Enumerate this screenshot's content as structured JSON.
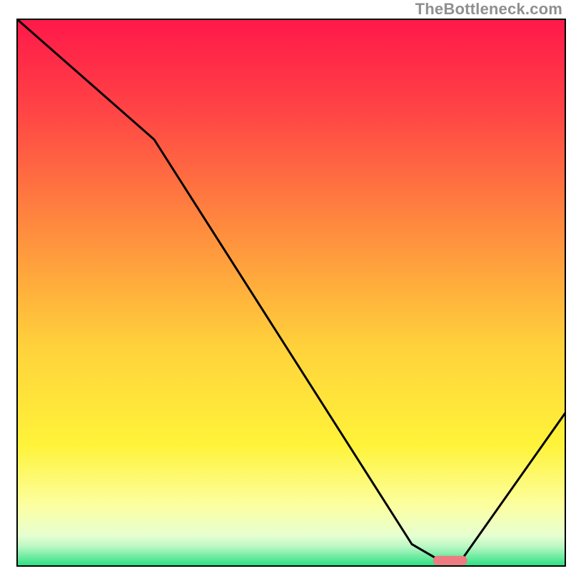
{
  "watermark": "TheBottleneck.com",
  "chart_data": {
    "type": "line",
    "title": "",
    "xlabel": "",
    "ylabel": "",
    "xlim": [
      0,
      100
    ],
    "ylim": [
      0,
      100
    ],
    "grid": false,
    "series": [
      {
        "name": "bottleneck-curve",
        "x": [
          0,
          25,
          72,
          78,
          79,
          81,
          100
        ],
        "values": [
          100,
          78,
          4,
          0.5,
          0.5,
          1,
          28
        ]
      }
    ],
    "marker": {
      "name": "optimal-range",
      "x_center": 79,
      "y": 1,
      "color": "#ee7b81"
    },
    "gradient_stops": [
      {
        "pct": 0,
        "color": "#ff184a"
      },
      {
        "pct": 17,
        "color": "#ff4545"
      },
      {
        "pct": 39,
        "color": "#ff8e3e"
      },
      {
        "pct": 60,
        "color": "#ffd23b"
      },
      {
        "pct": 78,
        "color": "#fff33a"
      },
      {
        "pct": 89,
        "color": "#fcffa1"
      },
      {
        "pct": 94.5,
        "color": "#e6ffd1"
      },
      {
        "pct": 96.5,
        "color": "#b8f7c4"
      },
      {
        "pct": 100,
        "color": "#2ae082"
      }
    ]
  }
}
